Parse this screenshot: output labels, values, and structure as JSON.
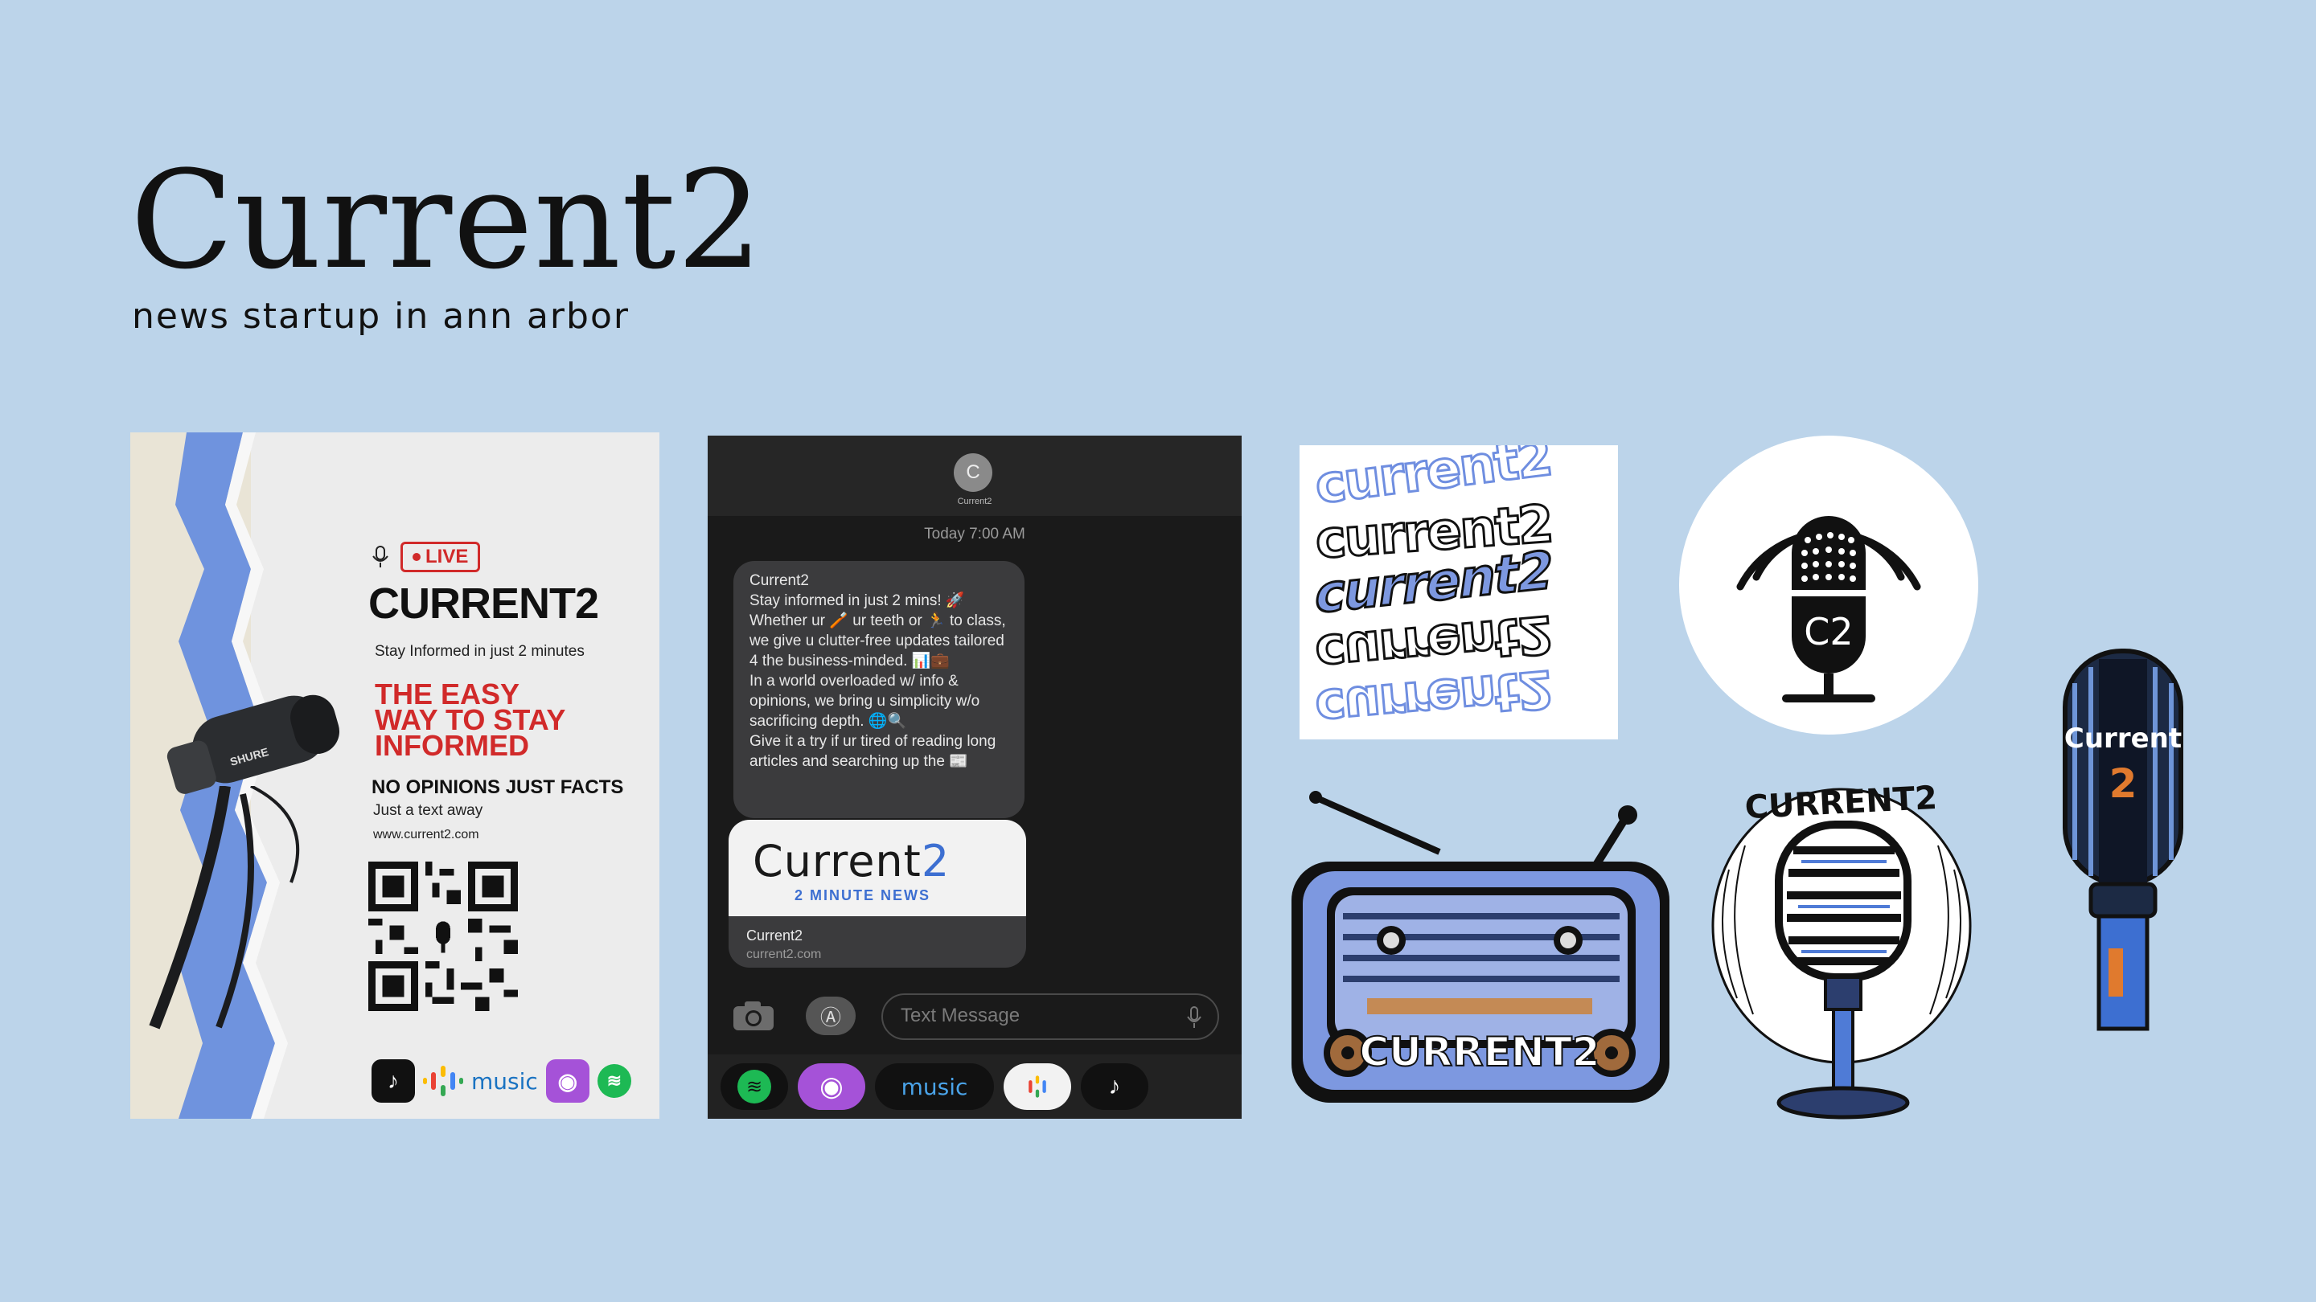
{
  "header": {
    "title": "Current2",
    "subtitle": "news startup in ann arbor"
  },
  "poster": {
    "live_label": "LIVE",
    "brand": "CURRENT2",
    "tagline": "Stay Informed in just 2 minutes",
    "headline_lines": [
      "THE EASY",
      "WAY TO STAY",
      "INFORMED"
    ],
    "headline_1": "THE EASY",
    "headline_2": "WAY TO STAY",
    "headline_3": "INFORMED",
    "no_opinions": "NO OPINIONS JUST FACTS",
    "text_away": "Just a text away",
    "url": "www.current2.com",
    "music_label": "music",
    "mic_brand": "SHURE"
  },
  "phone": {
    "avatar_letter": "C",
    "contact_name": "Current2",
    "timestamp": "Today 7:00 AM",
    "message": "Current2\nStay informed in just 2 mins! 🚀\nWhether ur 🪥 ur teeth or 🏃 to class, we give u clutter-free updates tailored 4 the business-minded. 📊💼\nIn a world overloaded w/ info & opinions, we bring u simplicity w/o sacrificing depth. 🌐🔍\nGive it a try if ur tired of reading long articles and searching up the 📰",
    "link_logo_prefix": "Current",
    "link_logo_suffix": "2",
    "link_subtitle": "2 MINUTE NEWS",
    "link_title": "Current2",
    "link_url": "current2.com",
    "input_placeholder": "Text Message",
    "dock_music_label": "music"
  },
  "stickers": {
    "text_sticker_lines": [
      "current2",
      "current2",
      "current2",
      "current2",
      "current2"
    ],
    "circle_logo_text": "C2",
    "radio_label": "CURRENT2",
    "mic_label": "CURRENT2",
    "retro_mic_word": "Current",
    "retro_mic_number": "2"
  },
  "colors": {
    "background": "#bcd4ea",
    "accent_red": "#d12a2a",
    "accent_blue": "#3d6fd1",
    "sticker_blue": "#7d98e0"
  }
}
